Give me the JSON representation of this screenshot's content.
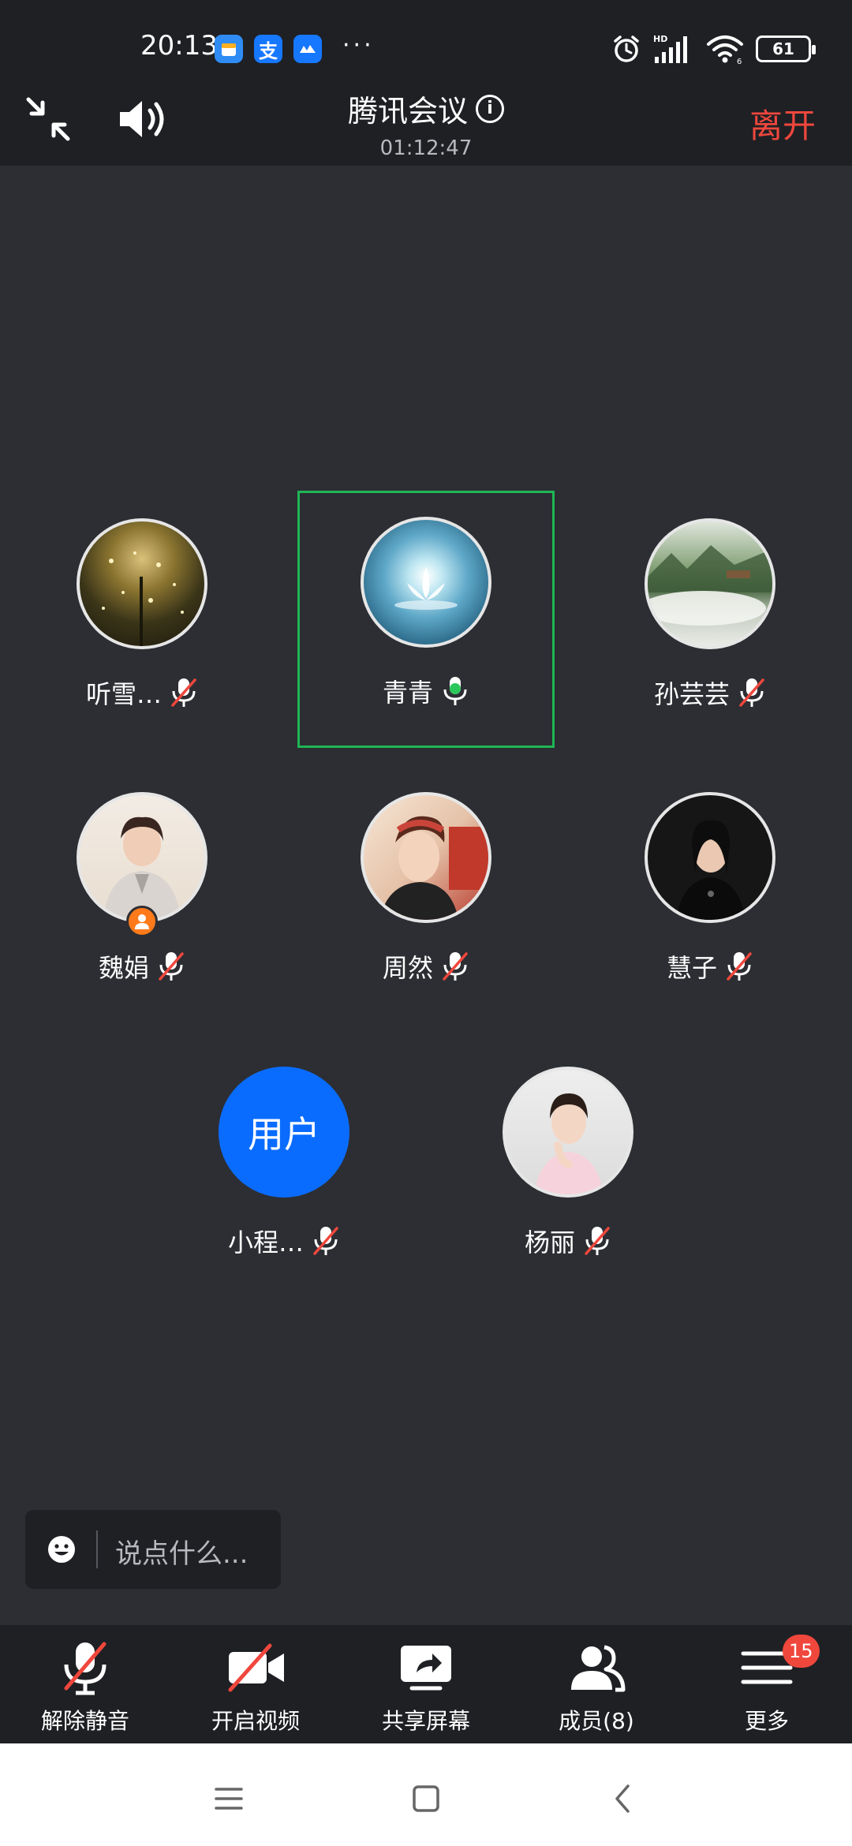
{
  "status_bar": {
    "time": "20:13",
    "apps": [
      "calendar-app-icon",
      "alipay-app-icon",
      "cloud-app-icon"
    ],
    "more": "···",
    "battery": "61"
  },
  "header": {
    "title": "腾讯会议",
    "duration": "01:12:47",
    "leave_label": "离开"
  },
  "participants": [
    {
      "name": "听雪…",
      "mic": "muted",
      "active": false
    },
    {
      "name": "青青",
      "mic": "speaking",
      "active": true
    },
    {
      "name": "孙芸芸",
      "mic": "muted",
      "active": false
    },
    {
      "name": "魏娟",
      "mic": "muted",
      "active": false,
      "host": true
    },
    {
      "name": "周然",
      "mic": "muted",
      "active": false
    },
    {
      "name": "慧子",
      "mic": "muted",
      "active": false
    },
    {
      "name": "小程…",
      "mic": "muted",
      "active": false,
      "avatar_text": "用户"
    },
    {
      "name": "杨丽",
      "mic": "muted",
      "active": false
    }
  ],
  "chat": {
    "placeholder": "说点什么..."
  },
  "toolbar": {
    "unmute": "解除静音",
    "video": "开启视频",
    "share": "共享屏幕",
    "members": "成员(8)",
    "more": "更多",
    "more_badge": "15"
  },
  "colors": {
    "background": "#2c2e33",
    "bar": "#1f2024",
    "leave": "#f0473d",
    "active_border": "#1fb655",
    "user_avatar": "#0a6cff"
  }
}
